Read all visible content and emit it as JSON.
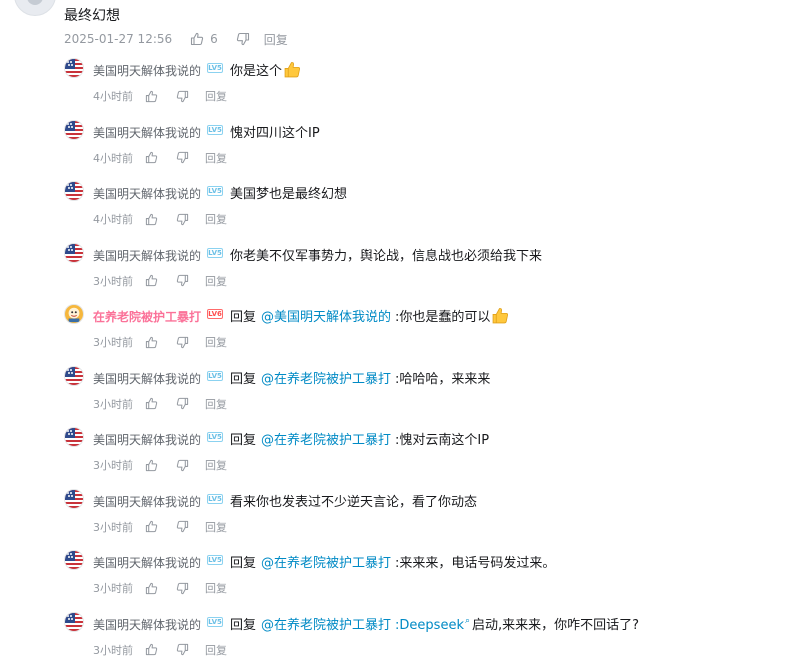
{
  "root": {
    "text": "最终幻想",
    "time": "2025-01-27 12:56",
    "likes": "6",
    "reply_label": "回复"
  },
  "reply_label": "回复",
  "replies": [
    {
      "user": "美国明天解体我说的",
      "level": "LV5",
      "content": "你是这个",
      "time": "4小时前",
      "thumb": true
    },
    {
      "user": "美国明天解体我说的",
      "level": "LV5",
      "content": "愧对四川这个IP",
      "time": "4小时前"
    },
    {
      "user": "美国明天解体我说的",
      "level": "LV5",
      "content": "美国梦也是最终幻想",
      "time": "4小时前"
    },
    {
      "user": "美国明天解体我说的",
      "level": "LV5",
      "content": "你老美不仅军事势力，舆论战，信息战也必须给我下来",
      "time": "3小时前"
    },
    {
      "user": "在养老院被护工暴打",
      "level": "LV6",
      "reply_word": "回复",
      "mention": "@美国明天解体我说的",
      "content": ":你也是蠢的可以",
      "time": "3小时前",
      "thumb": true
    },
    {
      "user": "美国明天解体我说的",
      "level": "LV5",
      "reply_word": "回复",
      "mention": "@在养老院被护工暴打",
      "content": ":哈哈哈，来来来",
      "time": "3小时前"
    },
    {
      "user": "美国明天解体我说的",
      "level": "LV5",
      "reply_word": "回复",
      "mention": "@在养老院被护工暴打",
      "content": ":愧对云南这个IP",
      "time": "3小时前"
    },
    {
      "user": "美国明天解体我说的",
      "level": "LV5",
      "content": "看来你也发表过不少逆天言论，看了你动态",
      "time": "3小时前"
    },
    {
      "user": "美国明天解体我说的",
      "level": "LV5",
      "reply_word": "回复",
      "mention": "@在养老院被护工暴打",
      "content": ":来来来，电话号码发过来。",
      "time": "3小时前"
    },
    {
      "user": "美国明天解体我说的",
      "level": "LV5",
      "reply_word": "回复",
      "mention": "@在养老院被护工暴打",
      "content_pre": ":Deepseek",
      "content": "启动,来来来，你咋不回话了?",
      "time": "3小时前"
    }
  ]
}
